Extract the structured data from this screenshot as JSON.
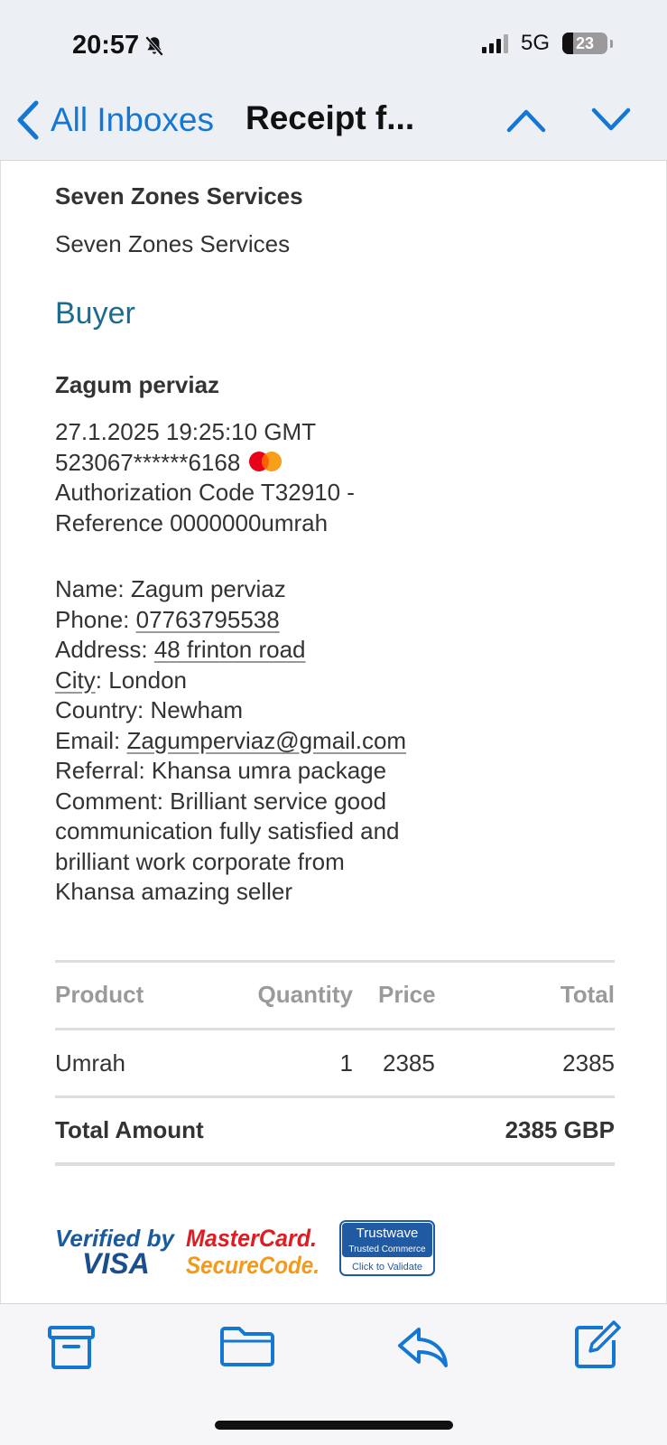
{
  "status_bar": {
    "time": "20:57",
    "network": "5G",
    "battery": "23"
  },
  "nav": {
    "back_label": "All Inboxes",
    "title": "Receipt f..."
  },
  "seller": {
    "name": "Seven Zones Services",
    "subtitle": "Seven Zones Services"
  },
  "buyer": {
    "heading": "Buyer",
    "name": "Zagum perviaz",
    "datetime": "27.1.2025 19:25:10 GMT",
    "card_number": "523067******6168",
    "auth_line": "Authorization Code T32910 -",
    "reference_line": "Reference 0000000umrah",
    "name_label": "Name: ",
    "name_value": "Zagum perviaz",
    "phone_label": "Phone: ",
    "phone_value": "07763795538",
    "address_label": "Address: ",
    "address_value": "48 frinton road",
    "city_label": "City",
    "city_value": ": London",
    "country_line": "Country: Newham",
    "email_label": "Email: ",
    "email_value": "Zagumperviaz@gmail.com",
    "referral_line": "Referral: Khansa umra package",
    "comment_lines": [
      "Comment: Brilliant service good",
      "communication fully satisfied and",
      "brilliant work corporate from",
      "Khansa amazing seller"
    ]
  },
  "table": {
    "headers": [
      "Product",
      "Quantity",
      "Price",
      "Total"
    ],
    "rows": [
      {
        "product": "Umrah",
        "quantity": "1",
        "price": "2385",
        "total": "2385"
      }
    ],
    "total_label": "Total Amount",
    "total_value": "2385 GBP"
  },
  "badges": {
    "visa_line1": "Verified by",
    "visa_line2": "VISA",
    "mc_line1": "MasterCard.",
    "mc_line2": "SecureCode.",
    "tw_line1": "Trustwave",
    "tw_line2": "Trusted Commerce",
    "tw_line3": "Click to Validate"
  },
  "colors": {
    "accent": "#1477d4",
    "heading": "#1d6b8f"
  }
}
